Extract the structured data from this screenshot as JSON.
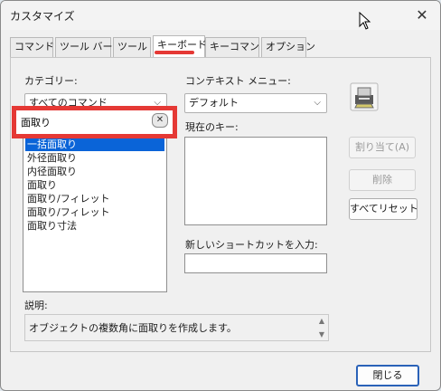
{
  "window": {
    "title": "カスタマイズ",
    "close_glyph": "✕"
  },
  "tabs": [
    {
      "label": "コマンド"
    },
    {
      "label": "ツール バー"
    },
    {
      "label": "ツール"
    },
    {
      "label": "キーボード"
    },
    {
      "label": "キーコマンド"
    },
    {
      "label": "オプション"
    }
  ],
  "active_tab": "キーボード",
  "accent_color": "#e53935",
  "category": {
    "label": "カテゴリー:",
    "selected": "すべてのコマンド"
  },
  "search": {
    "value": "面取り",
    "clear_glyph": "✕"
  },
  "commands": {
    "items": [
      "一括面取り",
      "外径面取り",
      "内径面取り",
      "面取り",
      "面取り/フィレット",
      "面取り/フィレット",
      "面取り寸法"
    ],
    "selected_index": 0
  },
  "context_menu": {
    "label": "コンテキスト メニュー:",
    "selected": "デフォルト"
  },
  "current_keys": {
    "label": "現在のキー:"
  },
  "new_shortcut": {
    "label": "新しいショートカットを入力:",
    "value": ""
  },
  "buttons": {
    "assign": "割り当て(A)",
    "delete": "削除",
    "reset_all": "すべてリセット",
    "close": "閉じる"
  },
  "description": {
    "label": "説明:",
    "text": "オブジェクトの複数角に面取りを作成します。"
  }
}
